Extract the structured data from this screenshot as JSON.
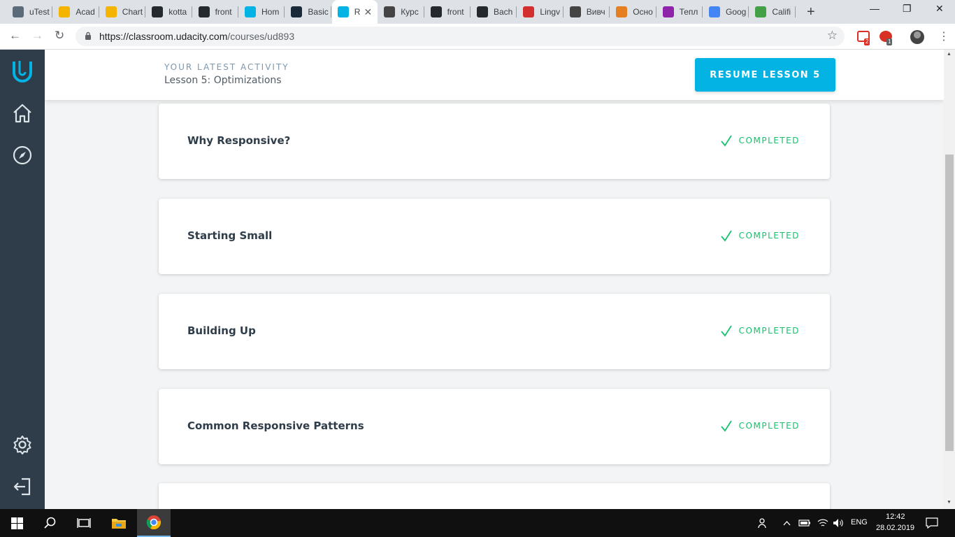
{
  "browser": {
    "tabs": [
      {
        "title": "uTest",
        "favicon": "utest-icon",
        "color": "#5b6b7a"
      },
      {
        "title": "Acad",
        "favicon": "slides-icon",
        "color": "#f4b400"
      },
      {
        "title": "Chart",
        "favicon": "slides-icon",
        "color": "#f4b400"
      },
      {
        "title": "kotta",
        "favicon": "github-icon",
        "color": "#24292e"
      },
      {
        "title": "front",
        "favicon": "github-icon",
        "color": "#24292e"
      },
      {
        "title": "Hom",
        "favicon": "udacity-icon",
        "color": "#02b3e4"
      },
      {
        "title": "Basic",
        "favicon": "bookmark-icon",
        "color": "#1b2a38"
      },
      {
        "title": "R",
        "favicon": "udacity-icon",
        "color": "#02b3e4",
        "active": true
      },
      {
        "title": "Курс",
        "favicon": "shield-icon",
        "color": "#444"
      },
      {
        "title": "front",
        "favicon": "github-icon",
        "color": "#24292e"
      },
      {
        "title": "Bach",
        "favicon": "github-icon",
        "color": "#24292e"
      },
      {
        "title": "Lingv",
        "favicon": "lingvo-icon",
        "color": "#d32f2f"
      },
      {
        "title": "Вивч",
        "favicon": "apps-icon",
        "color": "#444"
      },
      {
        "title": "Осно",
        "favicon": "search-icon",
        "color": "#e67e22"
      },
      {
        "title": "Тепл",
        "favicon": "m-icon",
        "color": "#8e24aa"
      },
      {
        "title": "Goog",
        "favicon": "translate-icon",
        "color": "#4285f4"
      },
      {
        "title": "Califi",
        "favicon": "leaf-icon",
        "color": "#43a047"
      }
    ],
    "url_host": "https://classroom.udacity.com",
    "url_path": "/courses/ud893",
    "gmail_badge": "2",
    "ext_badge": "1"
  },
  "header": {
    "kicker": "YOUR LATEST ACTIVITY",
    "lesson": "Lesson 5: Optimizations",
    "resume_label": "RESUME LESSON 5"
  },
  "lessons": [
    {
      "title": "Why Responsive?",
      "status": "COMPLETED"
    },
    {
      "title": "Starting Small",
      "status": "COMPLETED"
    },
    {
      "title": "Building Up",
      "status": "COMPLETED"
    },
    {
      "title": "Common Responsive Patterns",
      "status": "COMPLETED"
    }
  ],
  "taskbar": {
    "language": "ENG",
    "time": "12:42",
    "date": "28.02.2019"
  },
  "colors": {
    "accent": "#02b3e4",
    "sidebar": "#2e3d49",
    "completed": "#15c26b"
  }
}
